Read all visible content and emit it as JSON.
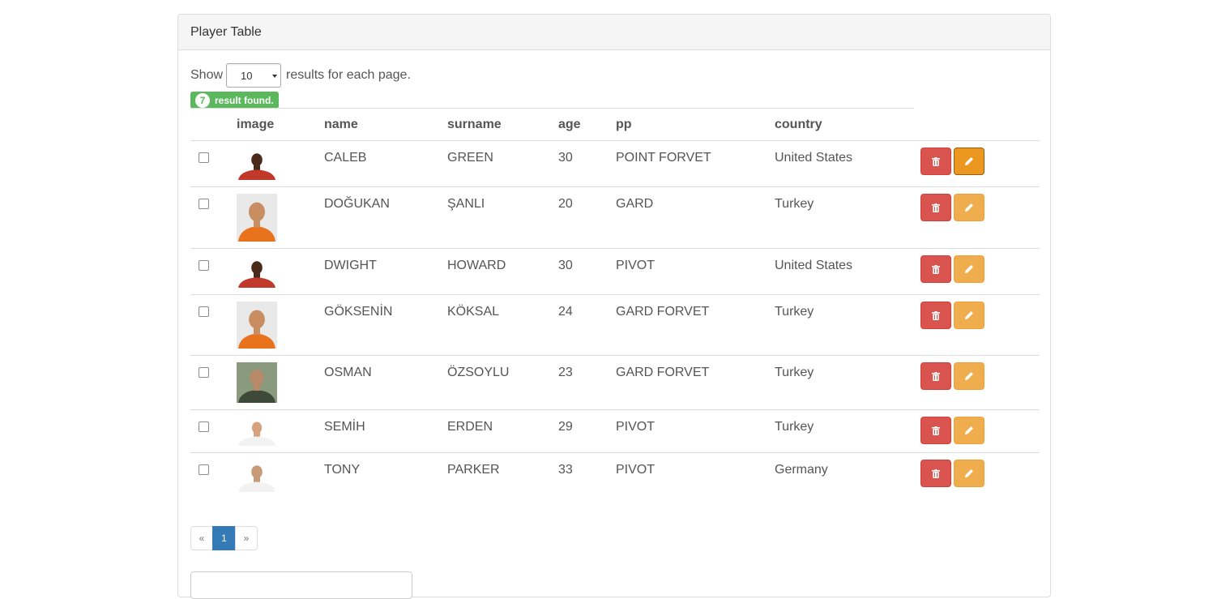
{
  "panel": {
    "title": "Player Table"
  },
  "controls": {
    "show_label": "Show",
    "page_size": "10",
    "suffix": "results for each page.",
    "found_count": "7",
    "found_text": "result found."
  },
  "columns": [
    "image",
    "name",
    "surname",
    "age",
    "pp",
    "country"
  ],
  "rows": [
    {
      "name": "CALEB",
      "surname": "GREEN",
      "age": "30",
      "pp": "POINT FORVET",
      "country": "United States",
      "jersey": "#c0392b",
      "skin": "#4a2a1a"
    },
    {
      "name": "DOĞUKAN",
      "surname": "ŞANLI",
      "age": "20",
      "pp": "GARD",
      "country": "Turkey",
      "jersey": "#e8731c",
      "skin": "#c98d62"
    },
    {
      "name": "DWIGHT",
      "surname": "HOWARD",
      "age": "30",
      "pp": "PIVOT",
      "country": "United States",
      "jersey": "#c0392b",
      "skin": "#4a2a1a"
    },
    {
      "name": "GÖKSENİN",
      "surname": "KÖKSAL",
      "age": "24",
      "pp": "GARD FORVET",
      "country": "Turkey",
      "jersey": "#e8731c",
      "skin": "#c98d62"
    },
    {
      "name": "OSMAN",
      "surname": "ÖZSOYLU",
      "age": "23",
      "pp": "GARD FORVET",
      "country": "Turkey",
      "jersey": "#3d4a3a",
      "skin": "#b88a6a"
    },
    {
      "name": "SEMİH",
      "surname": "ERDEN",
      "age": "29",
      "pp": "PIVOT",
      "country": "Turkey",
      "jersey": "#f2f2f2",
      "skin": "#d6a27d"
    },
    {
      "name": "TONY",
      "surname": "PARKER",
      "age": "33",
      "pp": "PIVOT",
      "country": "Germany",
      "jersey": "#f2f2f2",
      "skin": "#c89a7a"
    }
  ],
  "actions": {
    "delete_icon": "trash-icon",
    "edit_icon": "pencil-icon"
  },
  "pagination": {
    "prev": "«",
    "current": "1",
    "next": "»"
  },
  "colors": {
    "success": "#5cb85c",
    "danger": "#d9534f",
    "warning": "#f0ad4e",
    "primary": "#337ab7"
  }
}
